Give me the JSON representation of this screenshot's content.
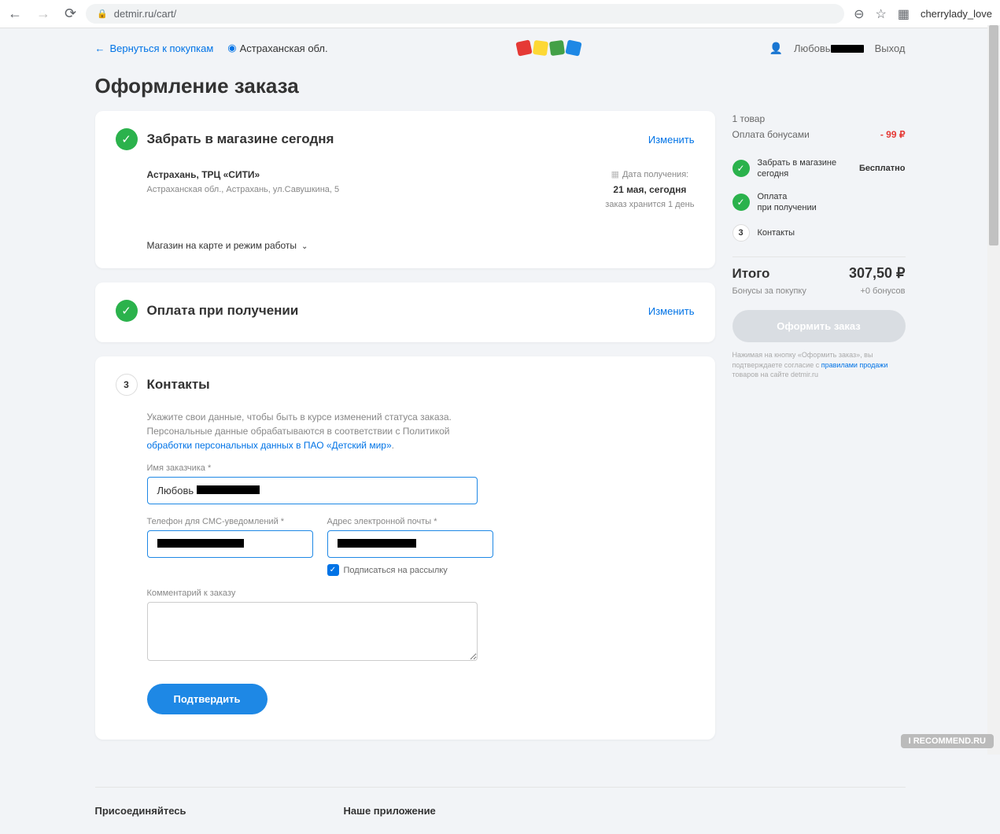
{
  "browser": {
    "url": "detmir.ru/cart/",
    "profile": "cherrylady_love"
  },
  "header": {
    "back": "Вернуться к покупкам",
    "region": "Астраханская обл.",
    "user_prefix": "Любовь",
    "logout": "Выход"
  },
  "page_title": "Оформление заказа",
  "pickup": {
    "title": "Забрать в магазине сегодня",
    "change": "Изменить",
    "store_name": "Астрахань, ТРЦ «СИТИ»",
    "store_addr": "Астраханская обл., Астрахань, ул.Савушкина, 5",
    "date_label": "Дата получения:",
    "date_value": "21 мая, сегодня",
    "storage": "заказ хранится 1 день",
    "map_toggle": "Магазин на карте и режим работы"
  },
  "payment": {
    "title": "Оплата при получении",
    "change": "Изменить"
  },
  "contacts": {
    "step": "3",
    "title": "Контакты",
    "desc_1": "Укажите свои данные, чтобы быть в курсе изменений статуса заказа. Персональные данные обрабатываются в соответствии с Политикой ",
    "desc_link": "обработки персональных данных в ПАО «Детский мир»",
    "name_label": "Имя заказчика *",
    "name_value": "Любовь",
    "phone_label": "Телефон для СМС-уведомлений *",
    "email_label": "Адрес электронной почты *",
    "subscribe": "Подписаться на рассылку",
    "comment_label": "Комментарий к заказу",
    "submit": "Подтвердить"
  },
  "summary": {
    "items": "1 товар",
    "bonus_label": "Оплата бонусами",
    "bonus_value": "- 99 ₽",
    "step1_line1": "Забрать в магазине",
    "step1_line2": "сегодня",
    "step1_free": "Бесплатно",
    "step2_line1": "Оплата",
    "step2_line2": "при получении",
    "step3_num": "3",
    "step3": "Контакты",
    "total_label": "Итого",
    "total_value": "307,50 ₽",
    "bonus_earn_label": "Бонусы за покупку",
    "bonus_earn_value": "+0 бонусов",
    "order_btn": "Оформить заказ",
    "disclaimer_1": "Нажимая на кнопку «Оформить заказ», вы подтверждаете согласие с ",
    "disclaimer_link": "правилами продажи",
    "disclaimer_2": " товаров на сайте detmir.ru"
  },
  "footer": {
    "join": "Присоединяйтесь",
    "app": "Наше приложение"
  },
  "watermark": "I RECOMMEND.RU"
}
